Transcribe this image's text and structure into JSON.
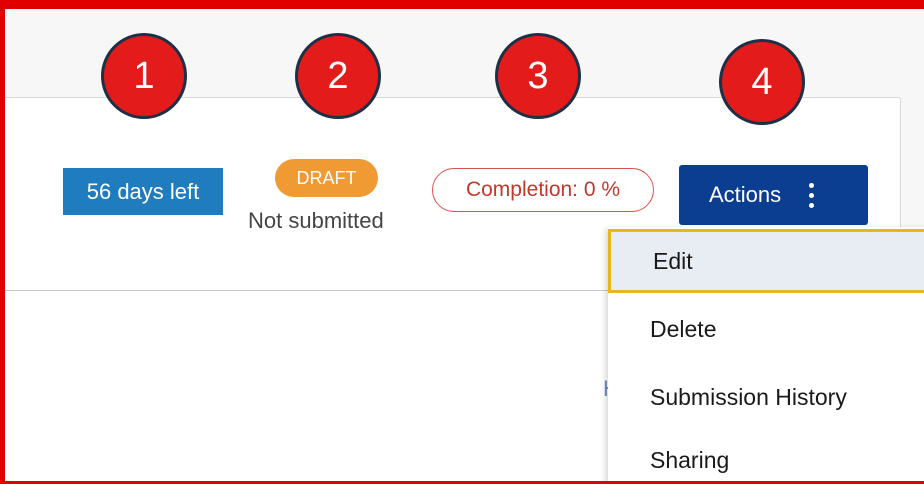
{
  "callouts": [
    "1",
    "2",
    "3",
    "4"
  ],
  "deadline_badge": "56 days left",
  "status": {
    "badge": "DRAFT",
    "text": "Not submitted"
  },
  "completion_label": "Completion: 0 %",
  "actions": {
    "label": "Actions",
    "icon": "kebab-vertical-icon"
  },
  "menu": {
    "items": [
      "Edit",
      "Delete",
      "Submission History",
      "Sharing"
    ],
    "highlighted": "Edit"
  },
  "peek_text": "H",
  "colors": {
    "callout_fill": "#e31b1b",
    "deadline": "#1f7cbf",
    "draft": "#f09a33",
    "completion_border": "#d9534f",
    "actions_button": "#0b3d91",
    "highlight_border": "#e6b820",
    "frame_border": "#e00000"
  }
}
